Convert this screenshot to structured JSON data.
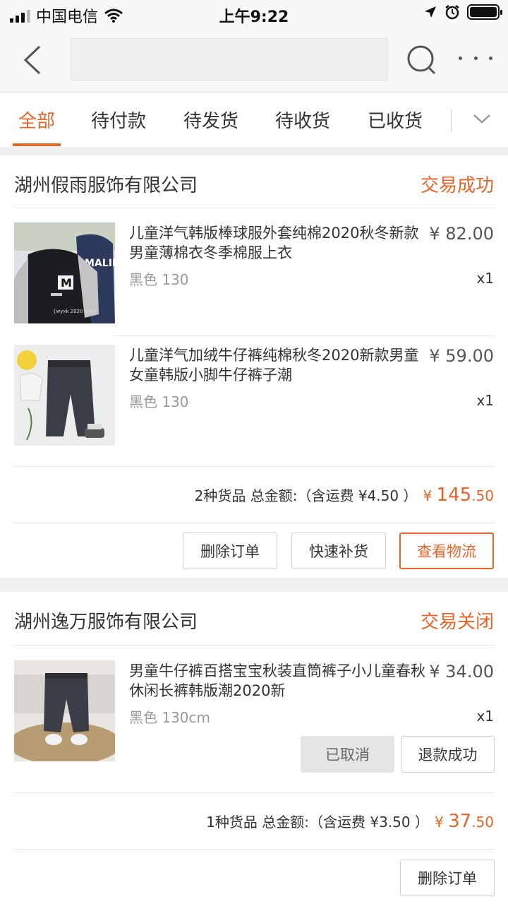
{
  "status_bar": {
    "carrier": "中国电信",
    "time": "上午9:22"
  },
  "nav": {
    "search_placeholder": ""
  },
  "tabs": [
    "全部",
    "待付款",
    "待发货",
    "待收货",
    "已收货"
  ],
  "orders": [
    {
      "shop": "湖州假雨服饰有限公司",
      "status": "交易成功",
      "items": [
        {
          "title": "儿童洋气韩版棒球服外套纯棉2020秋冬新款男童薄棉衣冬季棉服上衣",
          "spec": "黑色 130",
          "price": "¥ 82.00",
          "qty": "x1"
        },
        {
          "title": "儿童洋气加绒牛仔裤纯棉秋冬2020新款男童女童韩版小脚牛仔裤子潮",
          "spec": "黑色 130",
          "price": "¥ 59.00",
          "qty": "x1"
        }
      ],
      "summary": {
        "label": "2种货品 总金额:（含运费 ¥4.50 ）",
        "currency": "¥",
        "amount_int": "145",
        "amount_dec": ".50"
      },
      "buttons": [
        "删除订单",
        "快速补货",
        "查看物流"
      ]
    },
    {
      "shop": "湖州逸万服饰有限公司",
      "status": "交易关闭",
      "items": [
        {
          "title": "男童牛仔裤百搭宝宝秋装直筒裤子小儿童春秋休闲长裤韩版潮2020新",
          "spec": "黑色 130cm",
          "price": "¥ 34.00",
          "qty": "x1"
        }
      ],
      "item_buttons": [
        "已取消",
        "退款成功"
      ],
      "summary": {
        "label": "1种货品 总金额:（含运费 ¥3.50 ）",
        "currency": "¥",
        "amount_int": "37",
        "amount_dec": ".50"
      },
      "buttons": [
        "删除订单"
      ]
    }
  ],
  "colors": {
    "accent": "#e8652a"
  }
}
